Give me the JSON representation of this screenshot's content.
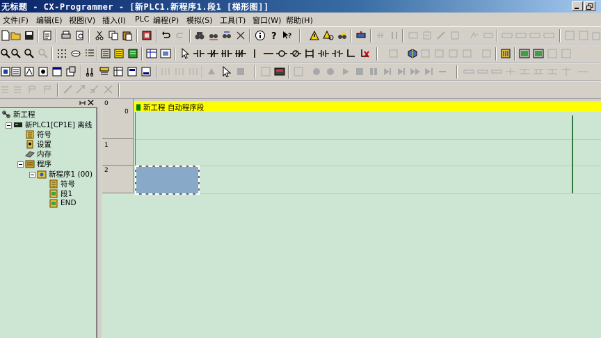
{
  "window": {
    "title": "无标题 - CX-Programmer - [新PLC1.新程序1.段1 [梯形图]]"
  },
  "menu": [
    "文件(F)",
    "编辑(E)",
    "视图(V)",
    "插入(I)",
    "PLC",
    "编程(P)",
    "模拟(S)",
    "工具(T)",
    "窗口(W)",
    "帮助(H)"
  ],
  "project_tree": {
    "project": "新工程",
    "plc": "新PLC1[CP1E] 离线",
    "symbols": "符号",
    "settings": "设置",
    "memory": "内存",
    "programs": "程序",
    "program1": "新程序1 (00)",
    "program_symbols": "符号",
    "section1": "段1",
    "end": "END"
  },
  "ladder": {
    "section_title": "新工程  自动程序段",
    "rungs": [
      {
        "number": "0",
        "step": "0"
      },
      {
        "number": "1",
        "step": ""
      },
      {
        "number": "2",
        "step": ""
      }
    ]
  },
  "colors": {
    "ladder_bg": "#cde6d4",
    "section_bar": "#ffff00",
    "cursor": "#88aac8"
  }
}
